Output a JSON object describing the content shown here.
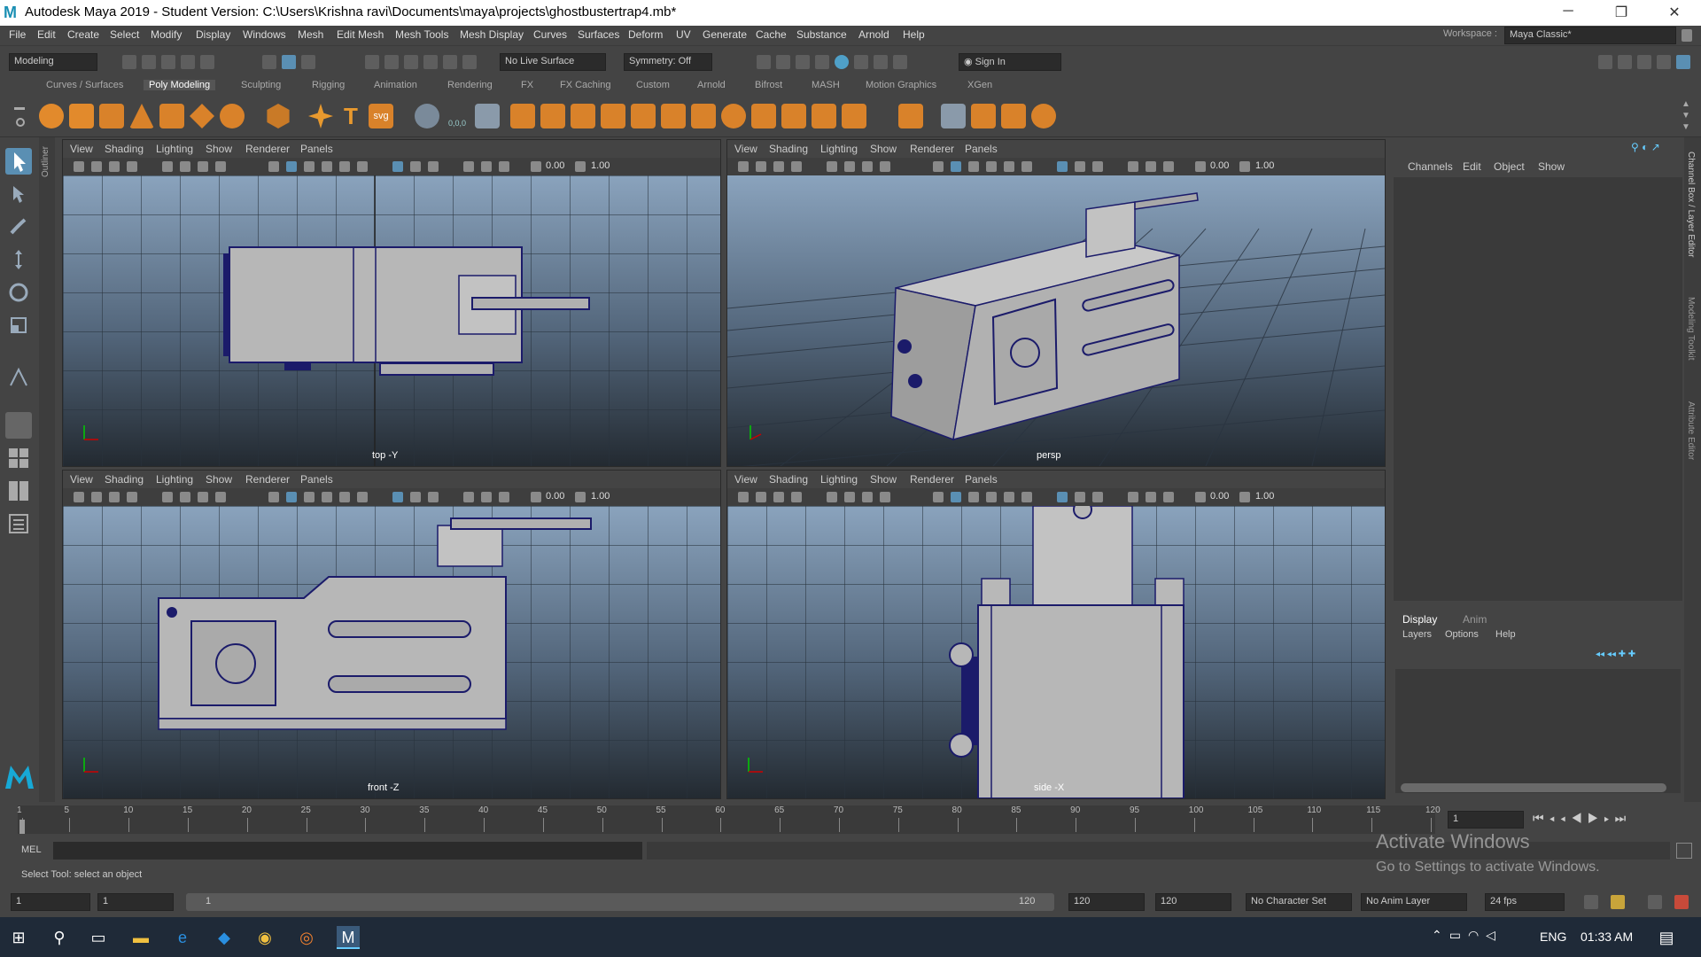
{
  "title": "Autodesk Maya 2019 - Student Version: C:\\Users\\Krishna ravi\\Documents\\maya\\projects\\ghostbustertrap4.mb*",
  "logo_letter": "M",
  "window_controls": [
    "─",
    "❐",
    "✕"
  ],
  "menus": [
    "File",
    "Edit",
    "Create",
    "Select",
    "Modify",
    "Display",
    "Windows",
    "Mesh",
    "Edit Mesh",
    "Mesh Tools",
    "Mesh Display",
    "Curves",
    "Surfaces",
    "Deform",
    "UV",
    "Generate",
    "Cache",
    "Substance",
    "Arnold",
    "Help"
  ],
  "workspace": {
    "label": "Workspace :",
    "value": "Maya Classic*"
  },
  "status": {
    "mode": "Modeling",
    "live_surface": "No Live Surface",
    "symmetry": "Symmetry: Off",
    "sign_in": "Sign In"
  },
  "shelf_tabs": [
    "Curves / Surfaces",
    "Poly Modeling",
    "Sculpting",
    "Rigging",
    "Animation",
    "Rendering",
    "FX",
    "FX Caching",
    "Custom",
    "Arnold",
    "Bifrost",
    "MASH",
    "Motion Graphics",
    "XGen"
  ],
  "shelf_active": "Poly Modeling",
  "shelf_text_icons": {
    "type": "T",
    "svg": "svg",
    "coord": "0,0,0"
  },
  "panel_menu": [
    "View",
    "Shading",
    "Lighting",
    "Show",
    "Renderer",
    "Panels"
  ],
  "panel_values": {
    "exposure": "0.00",
    "gamma": "1.00"
  },
  "viewports": [
    {
      "label": "top -Y"
    },
    {
      "label": "persp"
    },
    {
      "label": "front -Z"
    },
    {
      "label": "side -X"
    }
  ],
  "outliner_label": "Outliner",
  "channel_box": {
    "menus": [
      "Channels",
      "Edit",
      "Object",
      "Show"
    ]
  },
  "layer_editor": {
    "tabs": [
      "Display",
      "Anim"
    ],
    "menus": [
      "Layers",
      "Options",
      "Help"
    ]
  },
  "right_strip_labels": [
    "Channel Box / Layer Editor",
    "Modeling Toolkit",
    "Attribute Editor"
  ],
  "timeline": {
    "ticks": [
      "1",
      "5",
      "10",
      "15",
      "20",
      "25",
      "30",
      "35",
      "40",
      "45",
      "50",
      "55",
      "60",
      "65",
      "70",
      "75",
      "80",
      "85",
      "90",
      "95",
      "100",
      "105",
      "110",
      "115",
      "120"
    ],
    "current_frame": "1"
  },
  "mel_label": "MEL",
  "help_line": "Select Tool: select an object",
  "activate": {
    "line1": "Activate Windows",
    "line2": "Go to Settings to activate Windows."
  },
  "range": {
    "start": "1",
    "playback_start": "1",
    "slider_start": "1",
    "slider_end": "120",
    "playback_end": "120",
    "end": "120",
    "character_set": "No Character Set",
    "anim_layer": "No Anim Layer",
    "fps": "24 fps"
  },
  "taskbar": {
    "lang": "ENG",
    "time": "01:33 AM"
  }
}
